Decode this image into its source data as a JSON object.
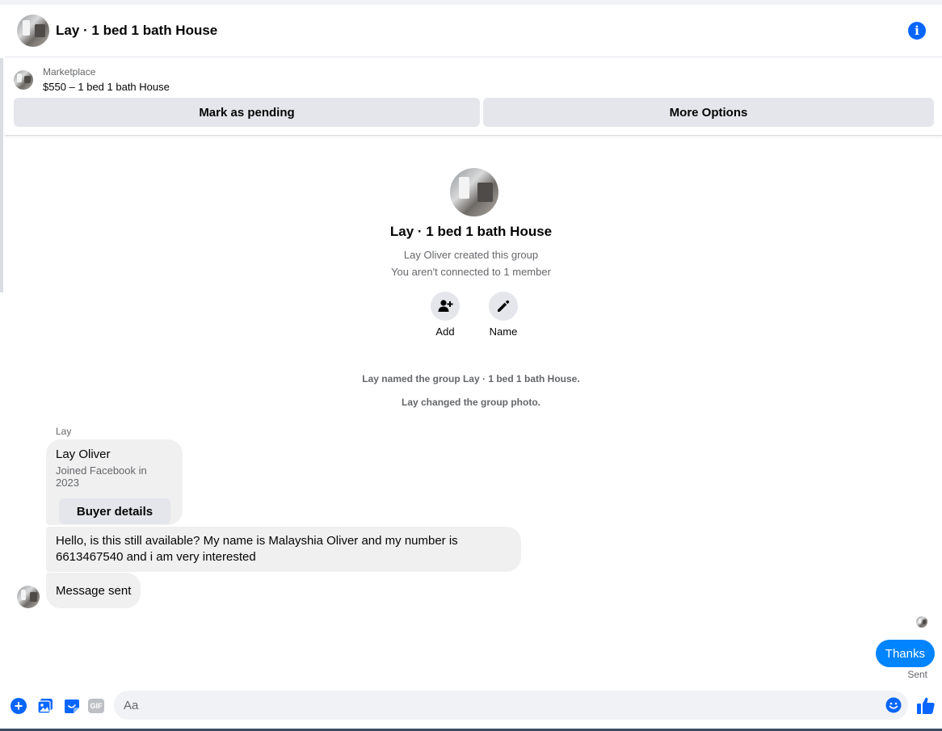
{
  "header": {
    "title": "Lay · 1 bed 1 bath House",
    "info_icon": "info-icon"
  },
  "marketplace": {
    "label": "Marketplace",
    "listing": "$550 – 1 bed 1 bath House",
    "mark_pending_label": "Mark as pending",
    "more_options_label": "More Options"
  },
  "group": {
    "name": "Lay · 1 bed 1 bath House",
    "created_by": "Lay Oliver created this group",
    "connection": "You aren't connected to 1 member",
    "actions": [
      {
        "label": "Add",
        "icon": "add-person-icon"
      },
      {
        "label": "Name",
        "icon": "pencil-icon"
      }
    ]
  },
  "system_messages": [
    "Lay named the group Lay · 1 bed 1 bath House.",
    "Lay changed the group photo."
  ],
  "conversation": {
    "sender_label": "Lay",
    "card": {
      "name": "Lay Oliver",
      "joined": "Joined Facebook in 2023",
      "button_label": "Buyer details"
    },
    "incoming": [
      "Hello, is this still available? My name is Malayshia Oliver and my number is 6613467540 and i am very interested",
      "Message sent"
    ],
    "outgoing": {
      "text": "Thanks",
      "status": "Sent"
    }
  },
  "composer": {
    "placeholder": "Aa",
    "icons": [
      "plus-icon",
      "photo-icon",
      "sticker-icon",
      "gif-icon",
      "emoji-icon",
      "like-icon"
    ],
    "gif_label": "GIF"
  },
  "colors": {
    "accent": "#0866ff",
    "outgoing_bubble": "#0084ff",
    "incoming_bubble": "#f0f0f0",
    "button_gray": "#e4e6eb",
    "secondary_text": "#65676b"
  }
}
